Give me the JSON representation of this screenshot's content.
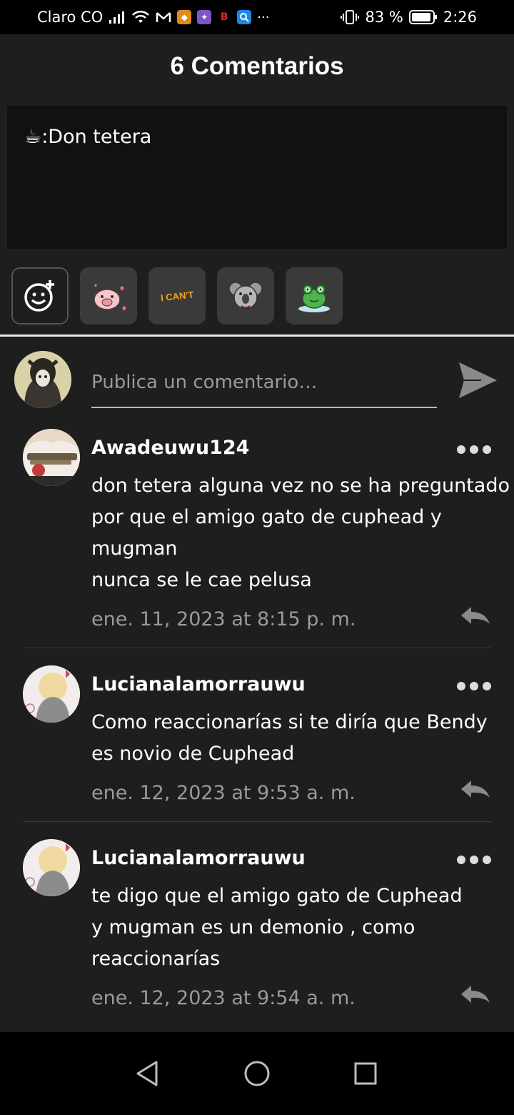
{
  "status_bar": {
    "carrier": "Claro CO",
    "battery": "83 %",
    "time": "2:26",
    "app_icons": [
      "signal-icon",
      "wifi-icon",
      "gmail-icon",
      "app-icon-orange",
      "app-icon-purple",
      "bilibili-icon",
      "search-app-icon",
      "more-icon"
    ]
  },
  "header": {
    "title": "6 Comentarios"
  },
  "post": {
    "text": "☕:Don tetera"
  },
  "stickers": [
    "add-sticker-icon",
    "pig-sticker",
    "i-cant-sticker",
    "koala-sticker",
    "frog-sticker"
  ],
  "sticker_text": {
    "i_cant": "I CAN'T"
  },
  "compose": {
    "placeholder": "Publica un comentario…"
  },
  "comments": [
    {
      "user": "Awadeuwu124",
      "lines": [
        "don tetera alguna vez no se ha preguntado",
        "por que el amigo gato de cuphead y",
        "mugman",
        "nunca se le cae pelusa"
      ],
      "date": "ene. 11, 2023 at 8:15 p. m."
    },
    {
      "user": "Lucianalamorrauwu",
      "lines": [
        "Como reaccionarías si te diría que Bendy",
        "es novio de Cuphead"
      ],
      "date": "ene. 12, 2023 at 9:53 a. m."
    },
    {
      "user": "Lucianalamorrauwu",
      "lines": [
        "te digo que el amigo gato de Cuphead",
        "y mugman es un demonio , como",
        "reaccionarías"
      ],
      "date": "ene. 12, 2023 at 9:54 a. m."
    }
  ],
  "colors": {
    "background": "#1e1e1e",
    "post_box": "#111111",
    "muted_text": "#9a9a9a",
    "sticker_bg": "#3a3a3a"
  }
}
